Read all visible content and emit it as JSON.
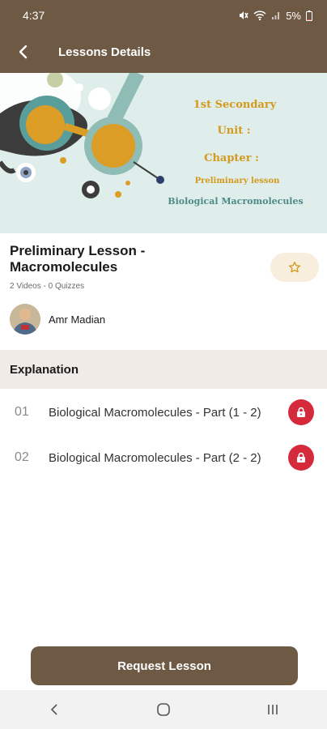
{
  "status_bar": {
    "time": "4:37",
    "battery": "5%"
  },
  "app_bar": {
    "title": "Lessons Details"
  },
  "banner": {
    "line1": "1st Secondary",
    "line2": "Unit :",
    "line3": "Chapter :",
    "line4": "Preliminary lesson",
    "line5": "Biological Macromolecules"
  },
  "lesson": {
    "title": "Preliminary Lesson - Macromolecules",
    "meta": "2 Videos - 0 Quizzes"
  },
  "instructor": {
    "name": "Amr Madian"
  },
  "section": {
    "title": "Explanation"
  },
  "lessons": [
    {
      "number": "01",
      "title": "Biological Macromolecules - Part (1 - 2)"
    },
    {
      "number": "02",
      "title": "Biological Macromolecules - Part (2 - 2)"
    }
  ],
  "actions": {
    "request_label": "Request Lesson"
  },
  "colors": {
    "brand": "#6e5a44",
    "accent": "#d49a1e",
    "lock": "#d42a3c"
  },
  "icons": [
    "back-arrow-icon",
    "star-icon",
    "lock-icon",
    "mute-icon",
    "wifi-icon",
    "signal-icon",
    "battery-icon"
  ]
}
